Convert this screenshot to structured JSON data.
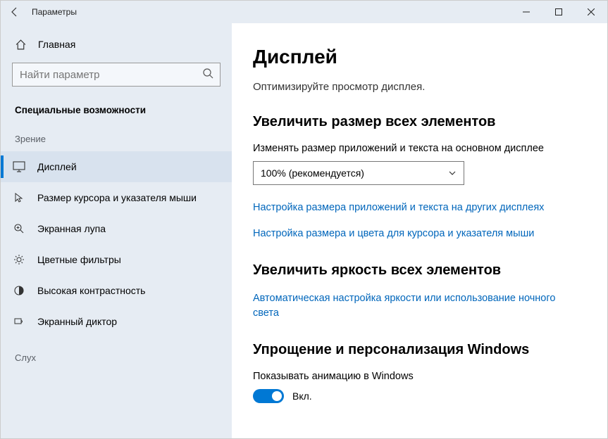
{
  "window": {
    "title": "Параметры"
  },
  "sidebar": {
    "home_label": "Главная",
    "search_placeholder": "Найти параметр",
    "section_title": "Специальные возможности",
    "group_vision": "Зрение",
    "group_hearing": "Слух",
    "items": [
      {
        "label": "Дисплей"
      },
      {
        "label": "Размер курсора и указателя мыши"
      },
      {
        "label": "Экранная лупа"
      },
      {
        "label": "Цветные фильтры"
      },
      {
        "label": "Высокая контрастность"
      },
      {
        "label": "Экранный диктор"
      }
    ]
  },
  "main": {
    "heading": "Дисплей",
    "subheading": "Оптимизируйте просмотр дисплея.",
    "section_scale_title": "Увеличить размер всех элементов",
    "scale_label": "Изменять размер приложений и текста на основном дисплее",
    "scale_value": "100% (рекомендуется)",
    "link_scale_other": "Настройка размера приложений и текста на других дисплеях",
    "link_cursor": "Настройка размера и цвета для курсора и указателя мыши",
    "section_brightness_title": "Увеличить яркость всех элементов",
    "link_brightness": "Автоматическая настройка яркости или использование ночного света",
    "section_simplify_title": "Упрощение и персонализация Windows",
    "toggle_anim_label": "Показывать анимацию в Windows",
    "toggle_on_text": "Вкл."
  }
}
